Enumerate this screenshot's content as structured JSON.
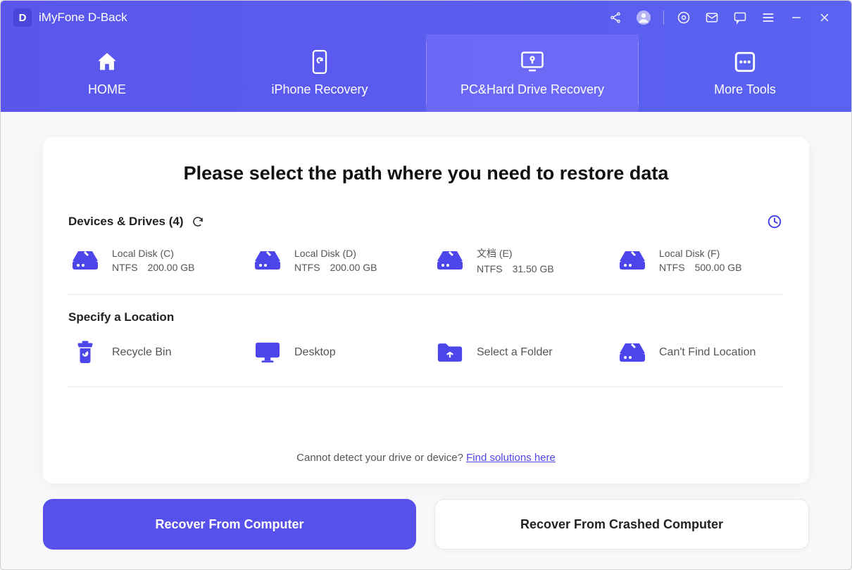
{
  "titlebar": {
    "logo_letter": "D",
    "app_name": "iMyFone D-Back"
  },
  "tabs": [
    {
      "label": "HOME"
    },
    {
      "label": "iPhone Recovery"
    },
    {
      "label": "PC&Hard Drive Recovery"
    },
    {
      "label": "More Tools"
    }
  ],
  "main": {
    "heading": "Please select the path where you need to restore data",
    "devices_header": "Devices & Drives (4)",
    "drives": [
      {
        "name": "Local Disk (C)",
        "fs": "NTFS",
        "size": "200.00 GB"
      },
      {
        "name": "Local Disk (D)",
        "fs": "NTFS",
        "size": "200.00 GB"
      },
      {
        "name": "文档 (E)",
        "fs": "NTFS",
        "size": "31.50 GB"
      },
      {
        "name": "Local Disk (F)",
        "fs": "NTFS",
        "size": "500.00 GB"
      }
    ],
    "locations_header": "Specify a Location",
    "locations": [
      {
        "label": "Recycle Bin"
      },
      {
        "label": "Desktop"
      },
      {
        "label": "Select a Folder"
      },
      {
        "label": "Can't Find Location"
      }
    ],
    "hint_text": "Cannot detect your drive or device? ",
    "hint_link": "Find solutions here"
  },
  "buttons": {
    "primary": "Recover From Computer",
    "secondary": "Recover From Crashed Computer"
  }
}
